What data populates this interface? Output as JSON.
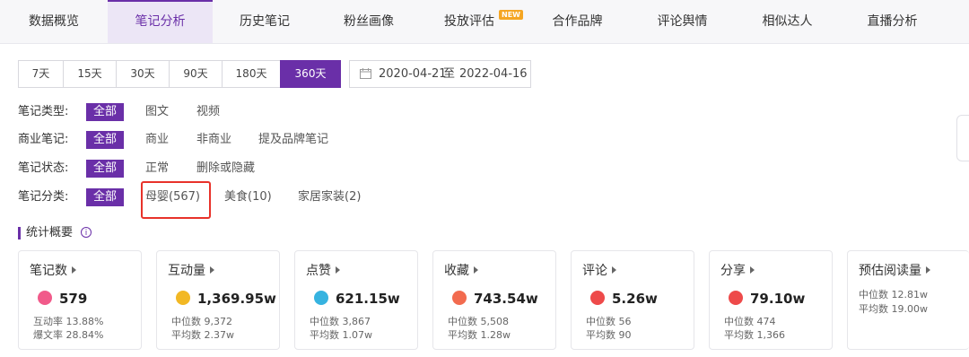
{
  "tabs": [
    {
      "label": "数据概览"
    },
    {
      "label": "笔记分析",
      "active": true
    },
    {
      "label": "历史笔记"
    },
    {
      "label": "粉丝画像"
    },
    {
      "label": "投放评估",
      "badge": "NEW"
    },
    {
      "label": "合作品牌"
    },
    {
      "label": "评论舆情"
    },
    {
      "label": "相似达人"
    },
    {
      "label": "直播分析"
    }
  ],
  "range": [
    "7天",
    "15天",
    "30天",
    "90天",
    "180天",
    "360天"
  ],
  "range_selected": "360天",
  "date": {
    "start": "2020-04-21",
    "to": "至",
    "end": "2022-04-16"
  },
  "filters": {
    "type": {
      "label": "笔记类型:",
      "options": [
        "全部",
        "图文",
        "视频"
      ]
    },
    "business": {
      "label": "商业笔记:",
      "options": [
        "全部",
        "商业",
        "非商业",
        "提及品牌笔记"
      ]
    },
    "status": {
      "label": "笔记状态:",
      "options": [
        "全部",
        "正常",
        "删除或隐藏"
      ]
    },
    "category": {
      "label": "笔记分类:",
      "options": [
        "全部",
        "母婴(567)",
        "美食(10)",
        "家居家装(2)"
      ]
    }
  },
  "section_title": "统计概要",
  "colors": {
    "accent": "#6a2fa8",
    "highlight": "#e8322a"
  },
  "cards": [
    {
      "title": "笔记数",
      "value": "579",
      "icon": "note-icon",
      "icon_color": "#f15a8a",
      "line1": "互动率 13.88%",
      "line2": "爆文率 28.84%"
    },
    {
      "title": "互动量",
      "value": "1,369.95w",
      "icon": "bulb-icon",
      "icon_color": "#f2b824",
      "line1": "中位数 9,372",
      "line2": "平均数 2.37w"
    },
    {
      "title": "点赞",
      "value": "621.15w",
      "icon": "thumb-icon",
      "icon_color": "#36b3e0",
      "line1": "中位数 3,867",
      "line2": "平均数 1.07w"
    },
    {
      "title": "收藏",
      "value": "743.54w",
      "icon": "collect-icon",
      "icon_color": "#f26b4f",
      "line1": "中位数 5,508",
      "line2": "平均数 1.28w"
    },
    {
      "title": "评论",
      "value": "5.26w",
      "icon": "comment-icon",
      "icon_color": "#ee4a4a",
      "line1": "中位数 56",
      "line2": "平均数 90"
    },
    {
      "title": "分享",
      "value": "79.10w",
      "icon": "share-icon",
      "icon_color": "#ee4a4a",
      "line1": "中位数 474",
      "line2": "平均数 1,366"
    },
    {
      "title": "预估阅读量",
      "line1": "中位数 12.81w",
      "line2": "平均数 19.00w"
    }
  ]
}
